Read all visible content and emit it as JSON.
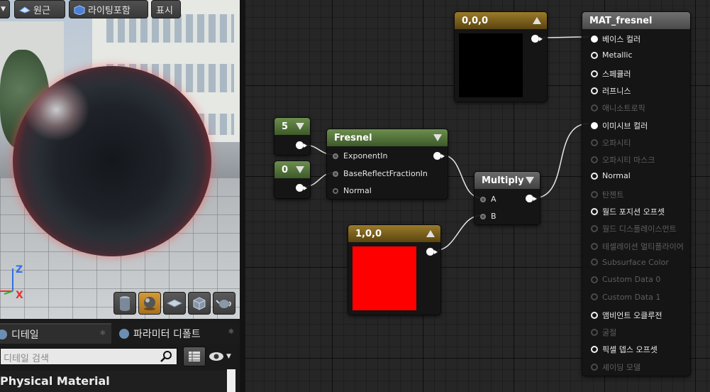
{
  "viewport": {
    "toolbar": {
      "perspective_label": "원근",
      "lighting_label": "라이팅포함",
      "show_label": "표시"
    },
    "axis": {
      "z": "Z",
      "x": "X"
    },
    "preview_tools": [
      "cylinder-icon",
      "sphere-icon",
      "plane-icon",
      "cube-icon",
      "teapot-icon"
    ]
  },
  "panel": {
    "tabs": [
      {
        "label": "디테일"
      },
      {
        "label": "파라미터 디폴트"
      }
    ],
    "search_placeholder": "디테일 검색",
    "section_title": "Physical Material"
  },
  "graph": {
    "nodes": {
      "const5": {
        "value": "5"
      },
      "const0": {
        "value": "0"
      },
      "fresnel": {
        "title": "Fresnel",
        "inputs": [
          "ExponentIn",
          "BaseReflectFractionIn",
          "Normal"
        ]
      },
      "multiply": {
        "title": "Multiply",
        "inputs": [
          "A",
          "B"
        ]
      },
      "color_black": {
        "title": "0,0,0",
        "swatch": "#000000"
      },
      "color_red": {
        "title": "1,0,0",
        "swatch": "#ff0000"
      },
      "material": {
        "title": "MAT_fresnel",
        "pins": [
          {
            "label": "베이스 컬러",
            "state": "connected"
          },
          {
            "label": "Metallic",
            "state": "enabled"
          },
          {
            "label": "스페큘러",
            "state": "enabled"
          },
          {
            "label": "러프니스",
            "state": "enabled"
          },
          {
            "label": "애니소트로픽",
            "state": "disabled"
          },
          {
            "label": "이미시브 컬러",
            "state": "connected"
          },
          {
            "label": "오파시티",
            "state": "disabled"
          },
          {
            "label": "오파시티 마스크",
            "state": "disabled"
          },
          {
            "label": "Normal",
            "state": "enabled"
          },
          {
            "label": "탄젠트",
            "state": "disabled"
          },
          {
            "label": "월드 포지션 오프셋",
            "state": "enabled"
          },
          {
            "label": "월드 디스플레이스먼트",
            "state": "disabled"
          },
          {
            "label": "테셀레이션 멀티플라이어",
            "state": "disabled"
          },
          {
            "label": "Subsurface Color",
            "state": "disabled"
          },
          {
            "label": "Custom Data 0",
            "state": "disabled"
          },
          {
            "label": "Custom Data 1",
            "state": "disabled"
          },
          {
            "label": "앰비언트 오클루전",
            "state": "enabled"
          },
          {
            "label": "굴절",
            "state": "disabled"
          },
          {
            "label": "픽셀 뎁스 오프셋",
            "state": "enabled"
          },
          {
            "label": "셰이딩 모델",
            "state": "disabled"
          }
        ]
      }
    }
  }
}
